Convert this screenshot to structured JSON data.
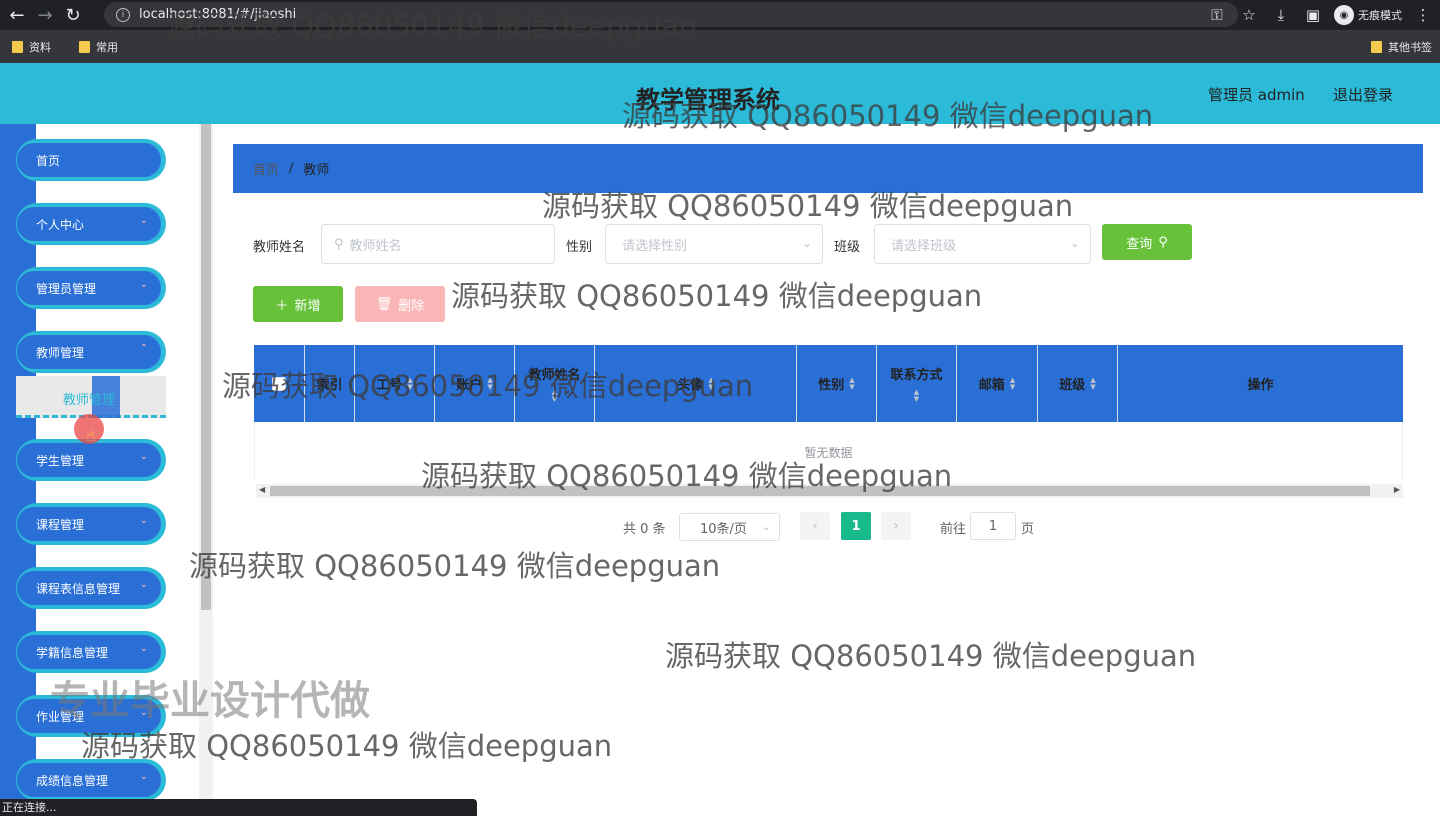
{
  "browser": {
    "url": "localhost:8081/#/jiaoshi",
    "incognito_label": "无痕模式",
    "bookmarks": [
      "资料",
      "常用"
    ],
    "other_bookmarks": "其他书签",
    "status": "正在连接..."
  },
  "header": {
    "title": "教学管理系统",
    "user": "管理员 admin",
    "logout": "退出登录"
  },
  "sidebar": {
    "items": [
      {
        "label": "首页"
      },
      {
        "label": "个人中心"
      },
      {
        "label": "管理员管理"
      },
      {
        "label": "教师管理"
      },
      {
        "label": "学生管理"
      },
      {
        "label": "课程管理"
      },
      {
        "label": "课程表信息管理"
      },
      {
        "label": "学籍信息管理"
      },
      {
        "label": "作业管理"
      },
      {
        "label": "成绩信息管理"
      }
    ],
    "submenu_active": "教师管理"
  },
  "breadcrumb": {
    "home": "首页",
    "separator": "/",
    "current": "教师"
  },
  "search": {
    "name_label": "教师姓名",
    "name_placeholder": "教师姓名",
    "gender_label": "性别",
    "gender_placeholder": "请选择性别",
    "class_label": "班级",
    "class_placeholder": "请选择班级",
    "query_button": "查询"
  },
  "actions": {
    "add": "新增",
    "delete": "删除"
  },
  "table": {
    "columns": [
      "索引",
      "工号",
      "账户",
      "教师姓名",
      "头像",
      "性别",
      "联系方式",
      "邮箱",
      "班级",
      "操作"
    ],
    "empty_text": "暂无数据"
  },
  "pagination": {
    "total": "共 0 条",
    "page_size": "10条/页",
    "current_page": "1",
    "goto_label": "前往",
    "goto_value": "1",
    "page_unit": "页"
  },
  "watermarks": {
    "text": "源码获取 QQ86050149 微信deepguan",
    "big": "专业毕业设计代做"
  },
  "colors": {
    "header_bg": "#2bbad8",
    "primary_blue": "#2a6fd6",
    "success_green": "#67c23a",
    "danger_light": "#fab6b6",
    "page_active": "#18b98a"
  }
}
